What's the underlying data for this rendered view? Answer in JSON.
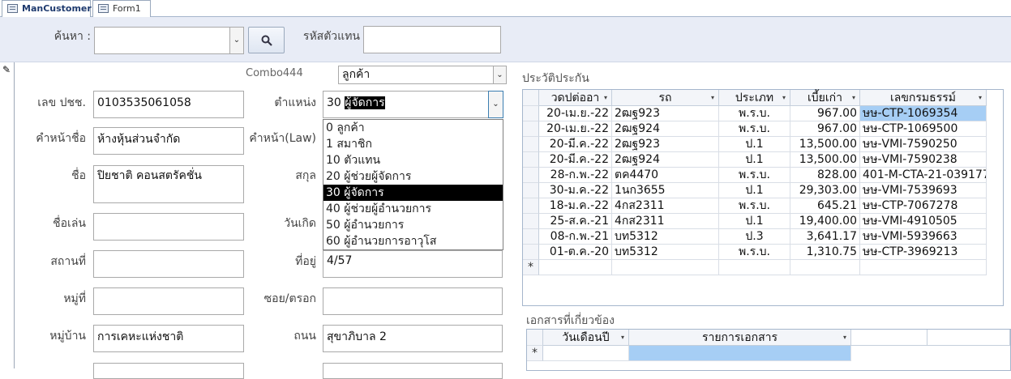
{
  "tabs": [
    {
      "label": "ManCustomer",
      "active": true
    },
    {
      "label": "Form1",
      "active": false
    }
  ],
  "search": {
    "label": "ค้นหา :",
    "value": "",
    "agent_code_label": "รหัสตัวแทน",
    "agent_code_value": ""
  },
  "combo444": {
    "label": "Combo444",
    "value": "ลูกค้า"
  },
  "form": {
    "tax_id_label": "เลข ปชช.",
    "tax_id": "0103535061058",
    "prefix_label": "คำหน้าชื่อ",
    "prefix": "ห้างหุ้นส่วนจำกัด",
    "name_label": "ชื่อ",
    "name": "ปิยชาติ คอนสตรัคชั่น",
    "nickname_label": "ชื่อเล่น",
    "nickname": "",
    "place_label": "สถานที่",
    "place": "",
    "moo_label": "หมู่ที่",
    "moo": "",
    "village_label": "หมู่บ้าน",
    "village": "การเคหะแห่งชาติ",
    "position_label": "ตำแหน่ง",
    "position": "30 ผู้จัดการ",
    "prefix_law_label": "คำหน้า(Law)",
    "surname_label": "สกุล",
    "birthday_label": "วันเกิด",
    "address_label": "ที่อยู่",
    "address": "4/57",
    "soi_label": "ซอย/ตรอก",
    "soi": "",
    "road_label": "ถนน",
    "road": "สุขาภิบาล 2"
  },
  "position_options": [
    "0 ลูกค้า",
    "1 สมาชิก",
    "10 ตัวแทน",
    "20 ผู้ช่วยผู้จัดการ",
    "30 ผู้จัดการ",
    "40 ผู้ช่วยผู้อำนวยการ",
    "50 ผู้อำนวยการ",
    "60 ผู้อำนวยการอาวุโส"
  ],
  "insurance": {
    "title": "ประวัติประกัน",
    "columns": [
      "วดปต่ออา",
      "รถ",
      "ประเภท",
      "เบี้ยเก่า",
      "เลขกรมธรรม์"
    ],
    "rows": [
      [
        "20-เม.ย.-22",
        "2ฒฐ923",
        "พ.ร.บ.",
        "967.00",
        "ษษ-CTP-1069354"
      ],
      [
        "20-เม.ย.-22",
        "2ฒฐ924",
        "พ.ร.บ.",
        "967.00",
        "ษษ-CTP-1069500"
      ],
      [
        "20-มี.ค.-22",
        "2ฒฐ923",
        "ป.1",
        "13,500.00",
        "ษษ-VMI-7590250"
      ],
      [
        "20-มี.ค.-22",
        "2ฒฐ924",
        "ป.1",
        "13,500.00",
        "ษษ-VMI-7590238"
      ],
      [
        "28-ก.พ.-22",
        "ตค4470",
        "พ.ร.บ.",
        "828.00",
        "401-M-CTA-21-039177"
      ],
      [
        "30-ม.ค.-22",
        "1นก3655",
        "ป.1",
        "29,303.00",
        "ษษ-VMI-7539693"
      ],
      [
        "18-ม.ค.-22",
        "4กส2311",
        "พ.ร.บ.",
        "645.21",
        "ษษ-CTP-7067278"
      ],
      [
        "25-ส.ค.-21",
        "4กส2311",
        "ป.1",
        "19,400.00",
        "ษษ-VMI-4910505"
      ],
      [
        "08-ก.พ.-21",
        "บท5312",
        "ป.3",
        "3,641.17",
        "ษษ-VMI-5939663"
      ],
      [
        "01-ต.ค.-20",
        "บท5312",
        "พ.ร.บ.",
        "1,310.75",
        "ษษ-CTP-3969213"
      ]
    ],
    "new_row_marker": "*"
  },
  "documents": {
    "title": "เอกสารที่เกี่ยวข้อง",
    "columns": [
      "วันเดือนปี",
      "รายการเอกสาร"
    ],
    "new_row_marker": "*"
  },
  "colors": {
    "header_band": "#e8ecf6",
    "selection_blue": "#a6cef5",
    "dropdown_selected": "#000000"
  }
}
